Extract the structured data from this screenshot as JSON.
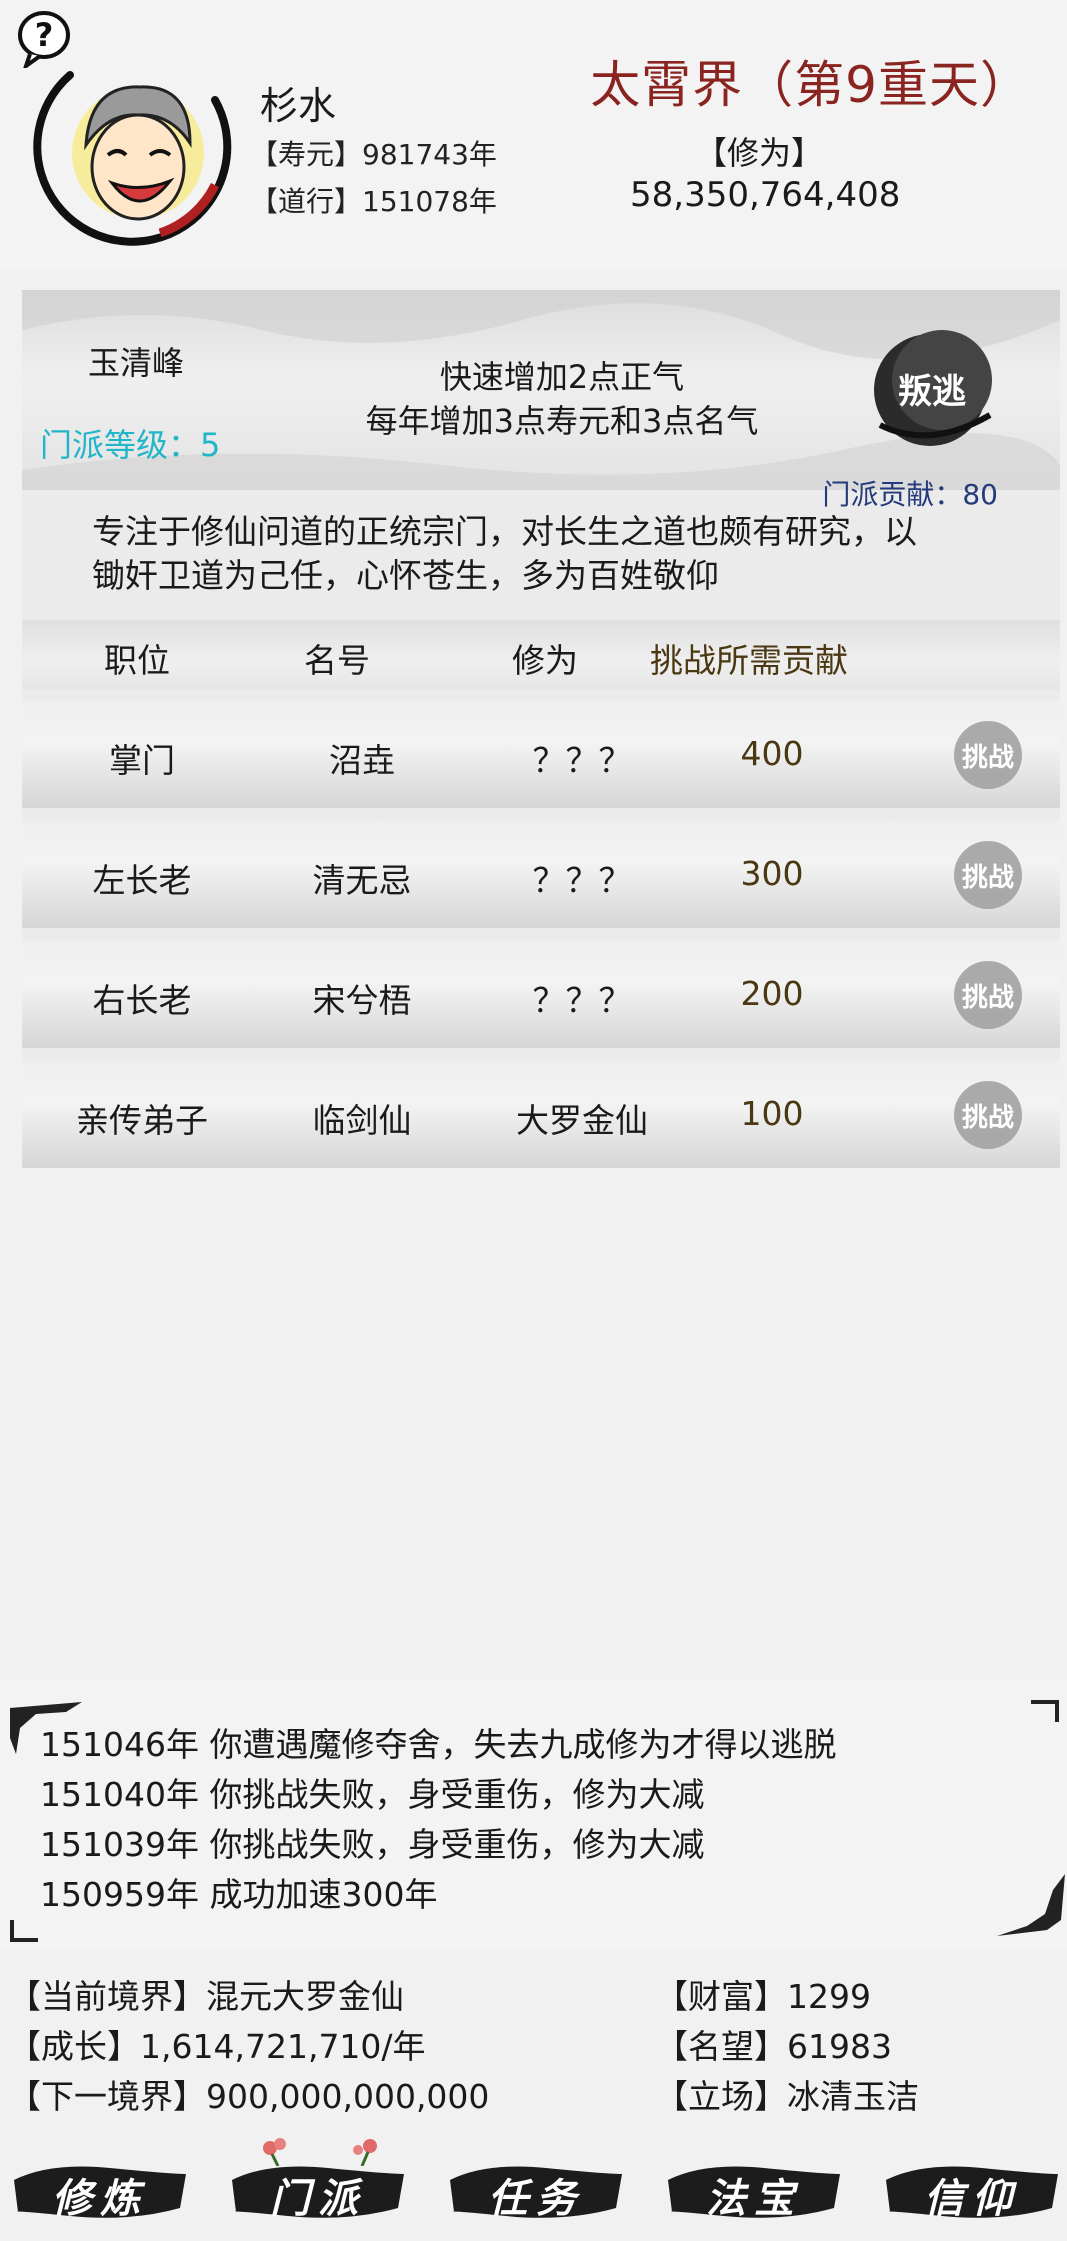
{
  "header": {
    "player_name": "杉水",
    "lifespan_label": "【寿元】",
    "lifespan_value": "981743年",
    "dao_label": "【道行】",
    "dao_value": "151078年",
    "realm_title": "太霄界（第9重天）",
    "cultivation_label": "【修为】",
    "cultivation_value": "58,350,764,408"
  },
  "sect": {
    "name": "玉清峰",
    "level_text": "门派等级：5",
    "effect_line1": "快速增加2点正气",
    "effect_line2": "每年增加3点寿元和3点名气",
    "betray_icon_label": "叛逃",
    "contribution_text": "门派贡献：80",
    "description_line1": "专注于修仙问道的正统宗门，对长生之道也颇有研究，以",
    "description_line2": "锄奸卫道为己任，心怀苍生，多为百姓敬仰",
    "table_headers": [
      "职位",
      "名号",
      "修为",
      "挑战所需贡献"
    ],
    "challenge_label": "挑战",
    "rows": [
      {
        "position": "掌门",
        "title": "沼垚",
        "cultivation": "？？？",
        "cost": "400"
      },
      {
        "position": "左长老",
        "title": "清无忌",
        "cultivation": "？？？",
        "cost": "300"
      },
      {
        "position": "右长老",
        "title": "宋兮梧",
        "cultivation": "？？？",
        "cost": "200"
      },
      {
        "position": "亲传弟子",
        "title": "临剑仙",
        "cultivation": "大罗金仙",
        "cost": "100"
      }
    ]
  },
  "log": [
    "151046年 你遭遇魔修夺舍，失去九成修为才得以逃脱",
    "151040年 你挑战失败，身受重伤，修为大减",
    "151039年 你挑战失败，身受重伤，修为大减",
    "150959年 成功加速300年"
  ],
  "status": {
    "realm": "【当前境界】混元大罗金仙",
    "growth": "【成长】1,614,721,710/年",
    "next_realm": "【下一境界】900,000,000,000",
    "wealth": "【财富】1299",
    "reputation": "【名望】61983",
    "stance": "【立场】冰清玉洁"
  },
  "nav": [
    "修炼",
    "门派",
    "任务",
    "法宝",
    "信仰"
  ],
  "colors": {
    "realm_title": "#8a2420",
    "sect_level": "#20b5c8",
    "contribution": "#243a7a",
    "cost": "#4a3812"
  }
}
